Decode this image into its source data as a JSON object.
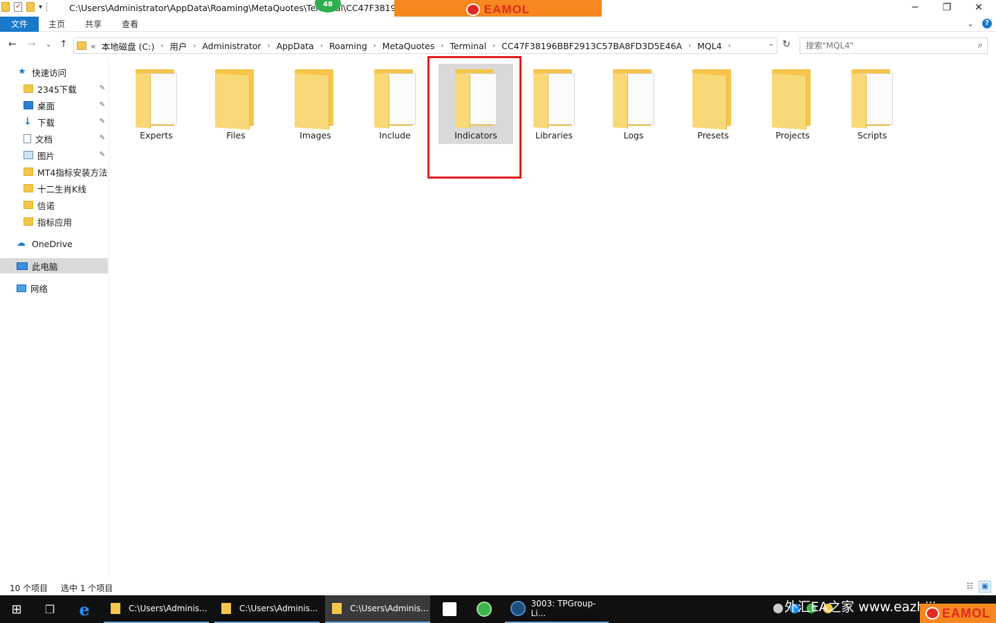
{
  "window": {
    "title": "C:\\Users\\Administrator\\AppData\\Roaming\\MetaQuotes\\Terminal\\CC47F38196BB",
    "badge": "48",
    "controls": {
      "minimize": "─",
      "restore": "❐",
      "close": "✕"
    }
  },
  "overlay_logo": {
    "text": "EAMOL",
    "color": "#f7871f"
  },
  "ribbon": {
    "tabs": [
      "文件",
      "主页",
      "共享",
      "查看"
    ],
    "expand": "⌄",
    "help": "?"
  },
  "nav": {
    "back": "←",
    "forward": "→",
    "recent": "⌄",
    "up": "↑",
    "overflow": "«",
    "breadcrumbs": [
      "本地磁盘 (C:)",
      "用户",
      "Administrator",
      "AppData",
      "Roaming",
      "MetaQuotes",
      "Terminal",
      "CC47F38196BBF2913C57BA8FD3D5E46A",
      "MQL4"
    ],
    "crumb_separator": "›",
    "dropdown": "⌄",
    "refresh": "↻"
  },
  "search": {
    "placeholder": "搜索\"MQL4\"",
    "icon": "⌕"
  },
  "sidebar": {
    "items": [
      {
        "label": "快速访问",
        "icon": "star",
        "pinned": false
      },
      {
        "label": "2345下载",
        "icon": "folder",
        "pinned": true
      },
      {
        "label": "桌面",
        "icon": "desktop",
        "pinned": true
      },
      {
        "label": "下载",
        "icon": "download",
        "pinned": true
      },
      {
        "label": "文档",
        "icon": "document",
        "pinned": true
      },
      {
        "label": "图片",
        "icon": "picture",
        "pinned": true
      },
      {
        "label": "MT4指标安装方法",
        "icon": "folder",
        "pinned": false
      },
      {
        "label": "十二生肖K线",
        "icon": "folder",
        "pinned": false
      },
      {
        "label": "信诺",
        "icon": "folder",
        "pinned": false
      },
      {
        "label": "指标应用",
        "icon": "folder",
        "pinned": false
      },
      {
        "label": "OneDrive",
        "icon": "cloud",
        "pinned": false
      },
      {
        "label": "此电脑",
        "icon": "pc",
        "pinned": false,
        "selected": true
      },
      {
        "label": "网络",
        "icon": "network",
        "pinned": false
      }
    ],
    "pin_glyph": "📌"
  },
  "folders": [
    {
      "name": "Experts",
      "style": "papers"
    },
    {
      "name": "Files",
      "style": "empty"
    },
    {
      "name": "Images",
      "style": "empty"
    },
    {
      "name": "Include",
      "style": "papers"
    },
    {
      "name": "Indicators",
      "style": "papers",
      "selected": true,
      "highlighted": true
    },
    {
      "name": "Libraries",
      "style": "papers"
    },
    {
      "name": "Logs",
      "style": "papers"
    },
    {
      "name": "Presets",
      "style": "empty"
    },
    {
      "name": "Projects",
      "style": "empty"
    },
    {
      "name": "Scripts",
      "style": "papers"
    }
  ],
  "highlight_color": "#e01b1b",
  "status": {
    "count": "10 个项目",
    "selected": "选中 1 个项目",
    "view_details": "☷",
    "view_icons": "▣"
  },
  "taskbar": {
    "start": "⊞",
    "task_view": "❐",
    "edge": "e",
    "apps": [
      {
        "label": "C:\\Users\\Adminis...",
        "active": false
      },
      {
        "label": "C:\\Users\\Adminis...",
        "active": false
      },
      {
        "label": "C:\\Users\\Adminis...",
        "active": true
      }
    ],
    "terminal_app": "3003: TPGroup-Li...",
    "watermark": "外汇EA之家 www.eazhijia.com",
    "tray_logo": "EAMOL"
  }
}
